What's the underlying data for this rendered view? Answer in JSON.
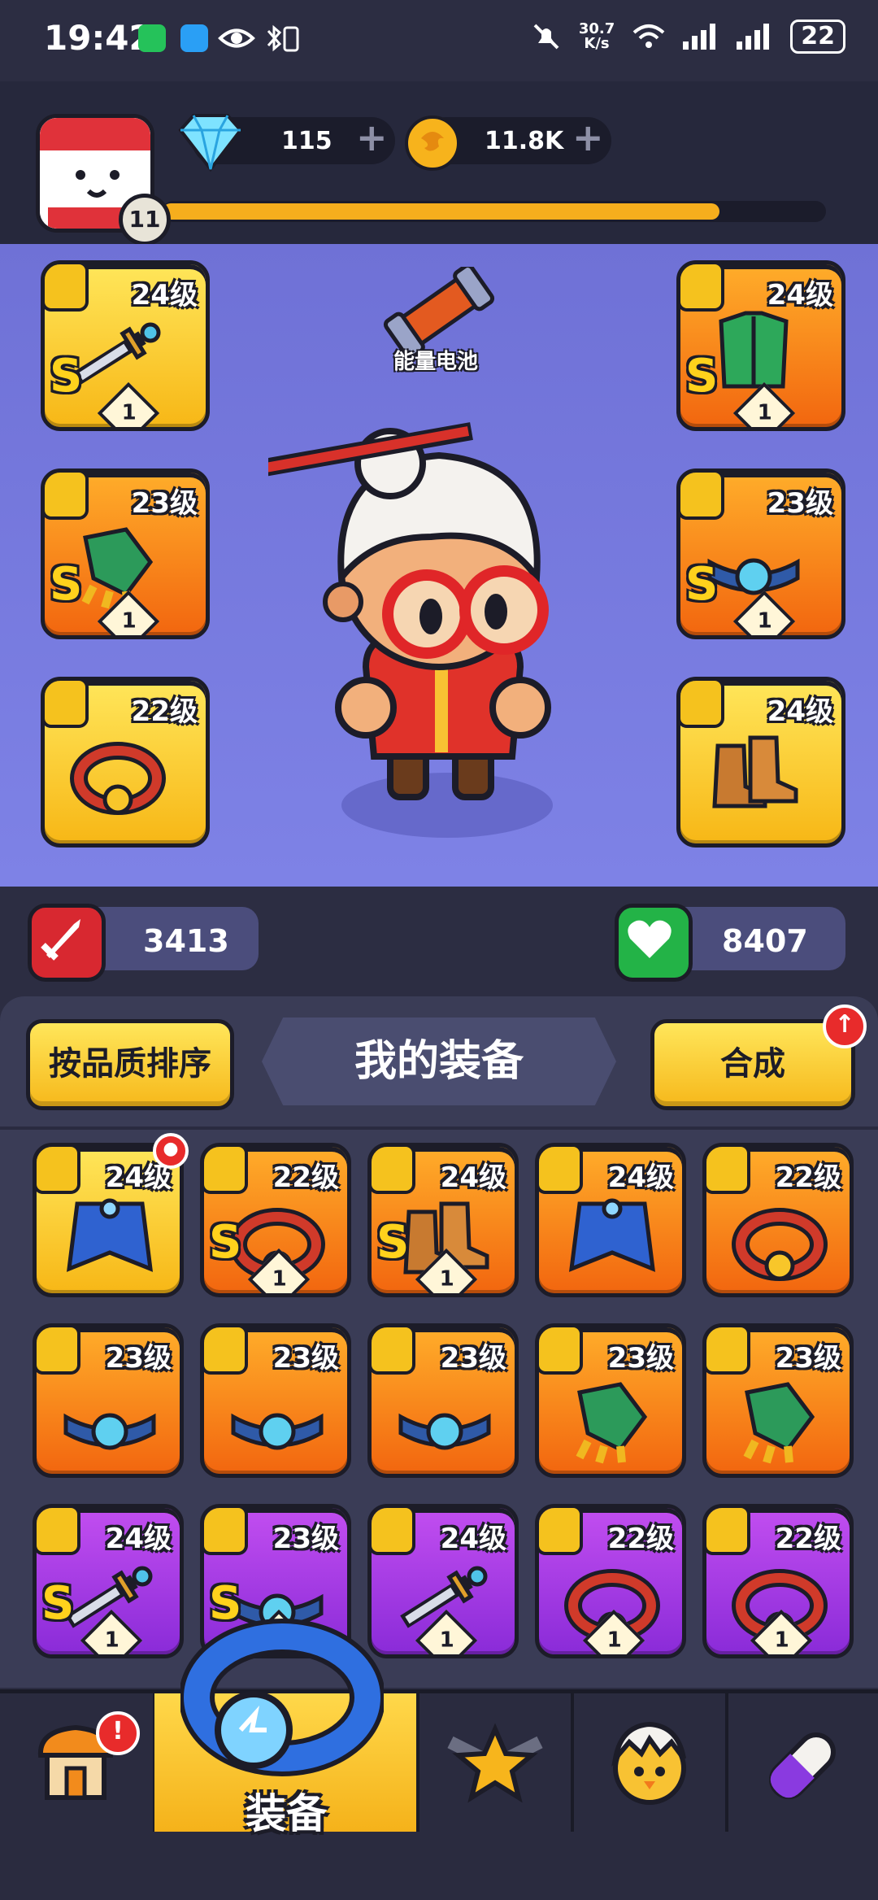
{
  "status_bar": {
    "time": "19:42",
    "net_speed": "30.7",
    "net_unit": "K/s",
    "battery": "22"
  },
  "header": {
    "player_level": "11",
    "xp_progress": 0.84,
    "gems": "115",
    "coins": "11.8K"
  },
  "stage": {
    "battery_label": "能量电池",
    "equipped_left": [
      {
        "level": "24级",
        "grade": "S",
        "stars": "1",
        "rarity": "gold",
        "item": "dagger-icon",
        "type": "weapon-icon"
      },
      {
        "level": "23级",
        "grade": "S",
        "stars": "1",
        "rarity": "orange",
        "item": "gauntlet-icon",
        "type": "glove-icon"
      },
      {
        "level": "22级",
        "grade": "",
        "stars": "",
        "rarity": "gold",
        "item": "ring-icon",
        "type": "ring-type-icon"
      }
    ],
    "equipped_right": [
      {
        "level": "24级",
        "grade": "S",
        "stars": "1",
        "rarity": "orange",
        "item": "armor-icon",
        "type": "vest-icon"
      },
      {
        "level": "23级",
        "grade": "S",
        "stars": "1",
        "rarity": "orange",
        "item": "belt-icon",
        "type": "belt-type-icon"
      },
      {
        "level": "24级",
        "grade": "",
        "stars": "",
        "rarity": "gold",
        "item": "boots-icon",
        "type": "boot-icon"
      }
    ]
  },
  "stats": {
    "attack": "3413",
    "health": "8407"
  },
  "panel": {
    "sort_label": "按品质排序",
    "title": "我的装备",
    "merge_label": "合成",
    "inventory": [
      {
        "level": "24级",
        "grade": "",
        "stars": "",
        "rarity": "gold",
        "item": "cape-icon"
      },
      {
        "level": "22级",
        "grade": "S",
        "stars": "1",
        "rarity": "orange",
        "item": "ring-icon"
      },
      {
        "level": "24级",
        "grade": "S",
        "stars": "1",
        "rarity": "orange",
        "item": "boots-icon"
      },
      {
        "level": "24级",
        "grade": "",
        "stars": "",
        "rarity": "orange",
        "item": "cape-icon"
      },
      {
        "level": "22级",
        "grade": "",
        "stars": "",
        "rarity": "orange",
        "item": "ring-icon"
      },
      {
        "level": "23级",
        "grade": "",
        "stars": "",
        "rarity": "orange",
        "item": "belt-icon"
      },
      {
        "level": "23级",
        "grade": "",
        "stars": "",
        "rarity": "orange",
        "item": "belt-icon"
      },
      {
        "level": "23级",
        "grade": "",
        "stars": "",
        "rarity": "orange",
        "item": "belt-icon"
      },
      {
        "level": "23级",
        "grade": "",
        "stars": "",
        "rarity": "orange",
        "item": "gauntlet-icon"
      },
      {
        "level": "23级",
        "grade": "",
        "stars": "",
        "rarity": "orange",
        "item": "gauntlet-icon"
      },
      {
        "level": "24级",
        "grade": "S",
        "stars": "1",
        "rarity": "purple",
        "item": "dagger-icon"
      },
      {
        "level": "23级",
        "grade": "S",
        "stars": "1",
        "rarity": "purple",
        "item": "belt-icon"
      },
      {
        "level": "24级",
        "grade": "",
        "stars": "1",
        "rarity": "purple",
        "item": "dagger-icon"
      },
      {
        "level": "22级",
        "grade": "",
        "stars": "1",
        "rarity": "purple",
        "item": "ring-icon"
      },
      {
        "level": "22级",
        "grade": "",
        "stars": "1",
        "rarity": "purple",
        "item": "ring-icon"
      }
    ]
  },
  "nav": {
    "active_label": "装备"
  },
  "colors": {
    "gold": "#f7b716",
    "orange": "#f2660f",
    "purple": "#8a2bd8",
    "accent_red": "#e82b2b"
  }
}
